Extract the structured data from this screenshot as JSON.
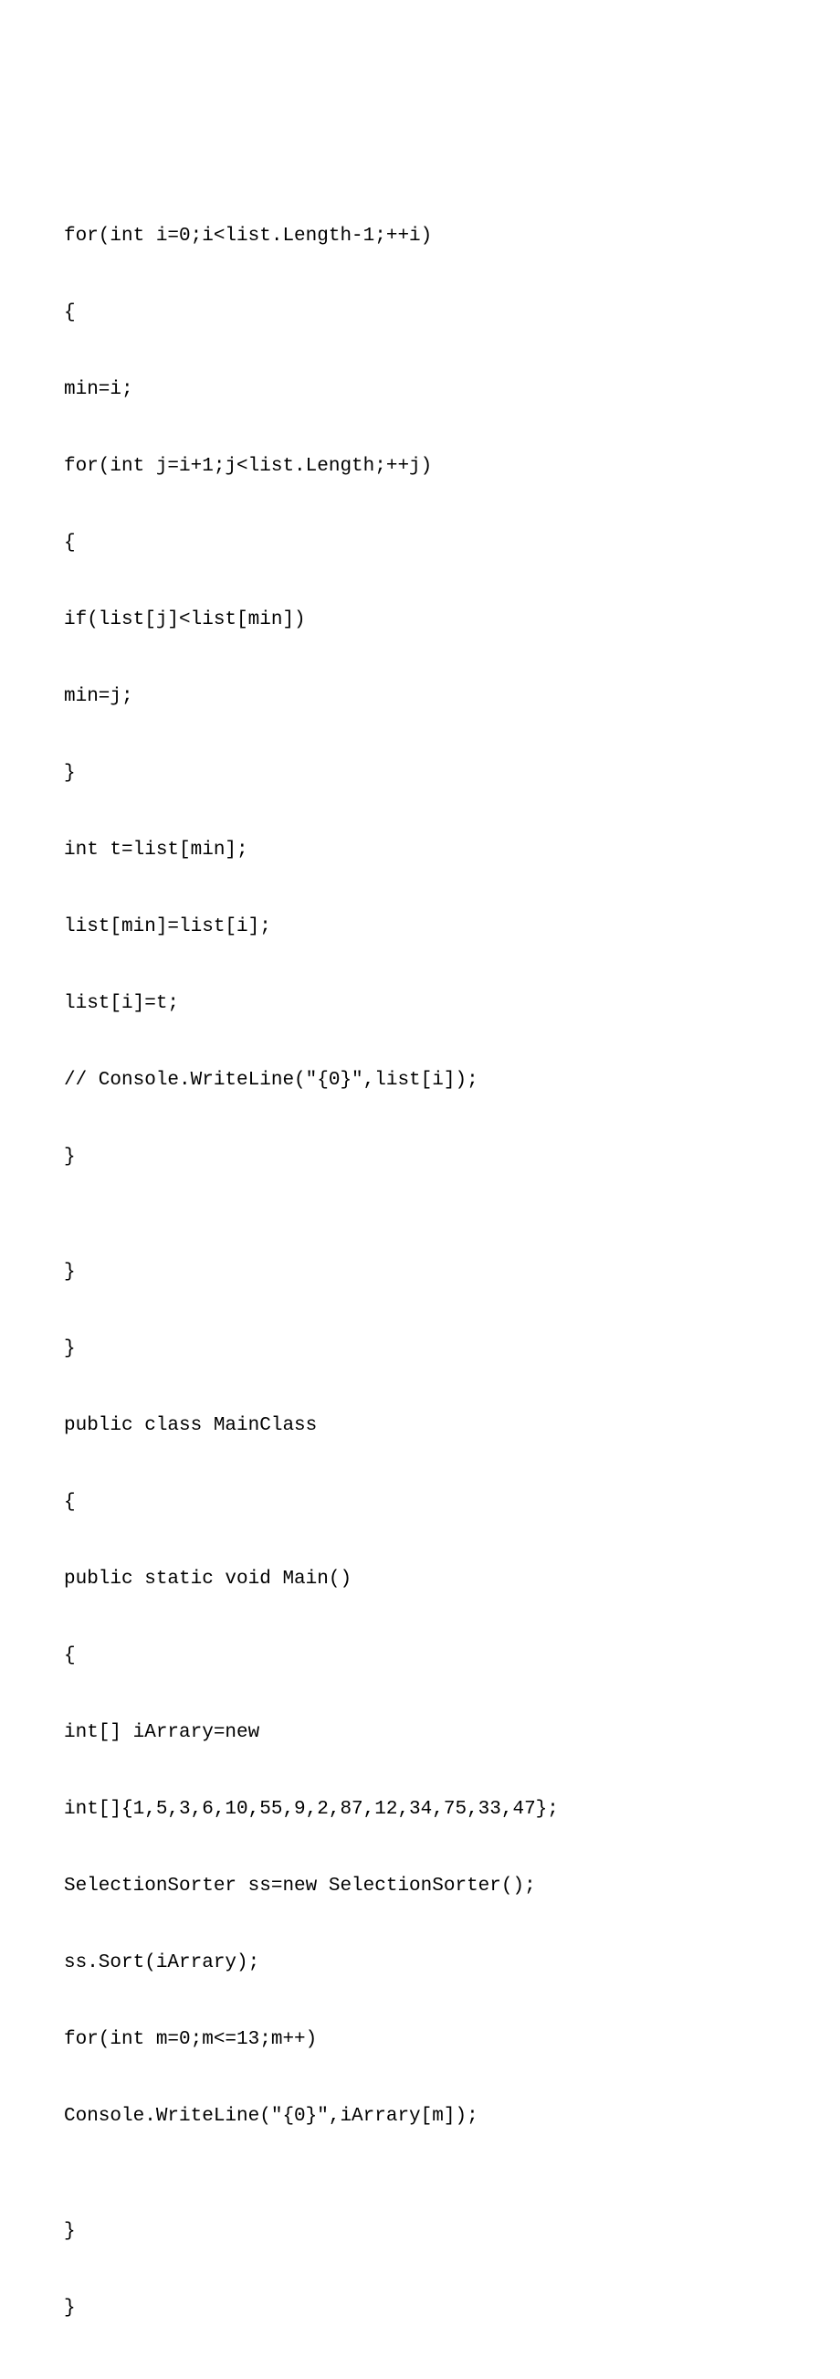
{
  "lines": [
    "for(int i=0;i<list.Length-1;++i)",
    "{",
    "min=i;",
    "for(int j=i+1;j<list.Length;++j)",
    "{",
    "if(list[j]<list[min])",
    "min=j;",
    "}",
    "int t=list[min];",
    "list[min]=list[i];",
    "list[i]=t;",
    "// Console.WriteLine(\"{0}\",list[i]);",
    "}",
    "",
    "}",
    "}",
    "public class MainClass",
    "{",
    "public static void Main()",
    "{",
    "int[] iArrary=new",
    "int[]{1,5,3,6,10,55,9,2,87,12,34,75,33,47};",
    "SelectionSorter ss=new SelectionSorter();",
    "ss.Sort(iArrary);",
    "for(int m=0;m<=13;m++)",
    "Console.WriteLine(\"{0}\",iArrary[m]);",
    "",
    "}",
    "}"
  ]
}
